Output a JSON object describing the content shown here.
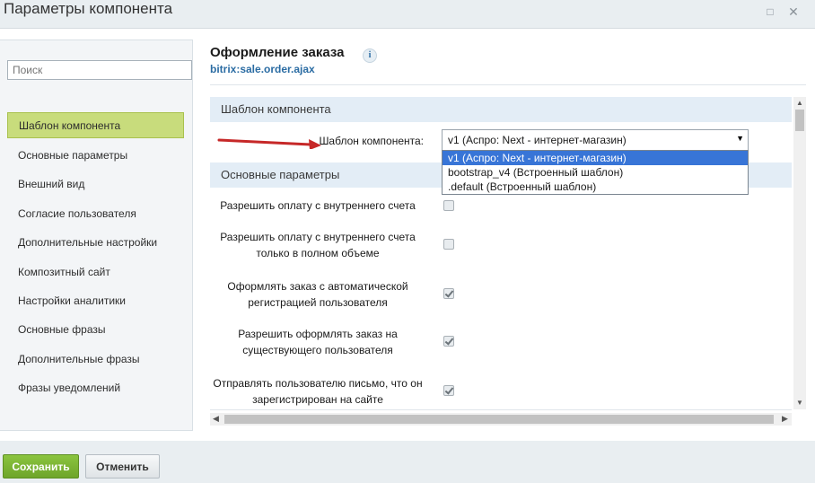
{
  "window": {
    "title": "Параметры компонента",
    "restore_icon": "restore-icon",
    "close_icon": "close-icon"
  },
  "sidebar": {
    "search_placeholder": "Поиск",
    "items": [
      {
        "label": "Шаблон компонента",
        "active": true
      },
      {
        "label": "Основные параметры"
      },
      {
        "label": "Внешний вид"
      },
      {
        "label": "Согласие пользователя"
      },
      {
        "label": "Дополнительные настройки"
      },
      {
        "label": "Композитный сайт"
      },
      {
        "label": "Настройки аналитики"
      },
      {
        "label": "Основные фразы"
      },
      {
        "label": "Дополнительные фразы"
      },
      {
        "label": "Фразы уведомлений"
      }
    ]
  },
  "header": {
    "title": "Оформление заказа",
    "code": "bitrix:sale.order.ajax",
    "info_icon": "i"
  },
  "sections": {
    "template": {
      "heading": "Шаблон компонента",
      "label": "Шаблон компонента:",
      "selected": "v1 (Аспро: Next - интернет-магазин)",
      "options": [
        "v1 (Аспро: Next - интернет-магазин)",
        "bootstrap_v4 (Встроенный шаблон)",
        ".default (Встроенный шаблон)"
      ]
    },
    "main": {
      "heading": "Основные параметры",
      "rows": [
        {
          "label": "Разрешить оплату с внутреннего счета",
          "checked": false
        },
        {
          "label": "Разрешить оплату с внутреннего счета только в полном объеме",
          "checked": false
        },
        {
          "label": "Оформлять заказ с автоматической регистрацией пользователя",
          "checked": true
        },
        {
          "label": "Разрешить оформлять заказ на существующего пользователя",
          "checked": true
        },
        {
          "label": "Отправлять пользователю письмо, что он зарегистрирован на сайте",
          "checked": true
        }
      ]
    }
  },
  "footer": {
    "save_label": "Сохранить",
    "cancel_label": "Отменить"
  },
  "colors": {
    "accent_green": "#6ea52a",
    "active_nav": "#c8dc7c",
    "section_header": "#e3edf6",
    "link_blue": "#2b6ca3",
    "annotation_arrow": "#c62828"
  }
}
